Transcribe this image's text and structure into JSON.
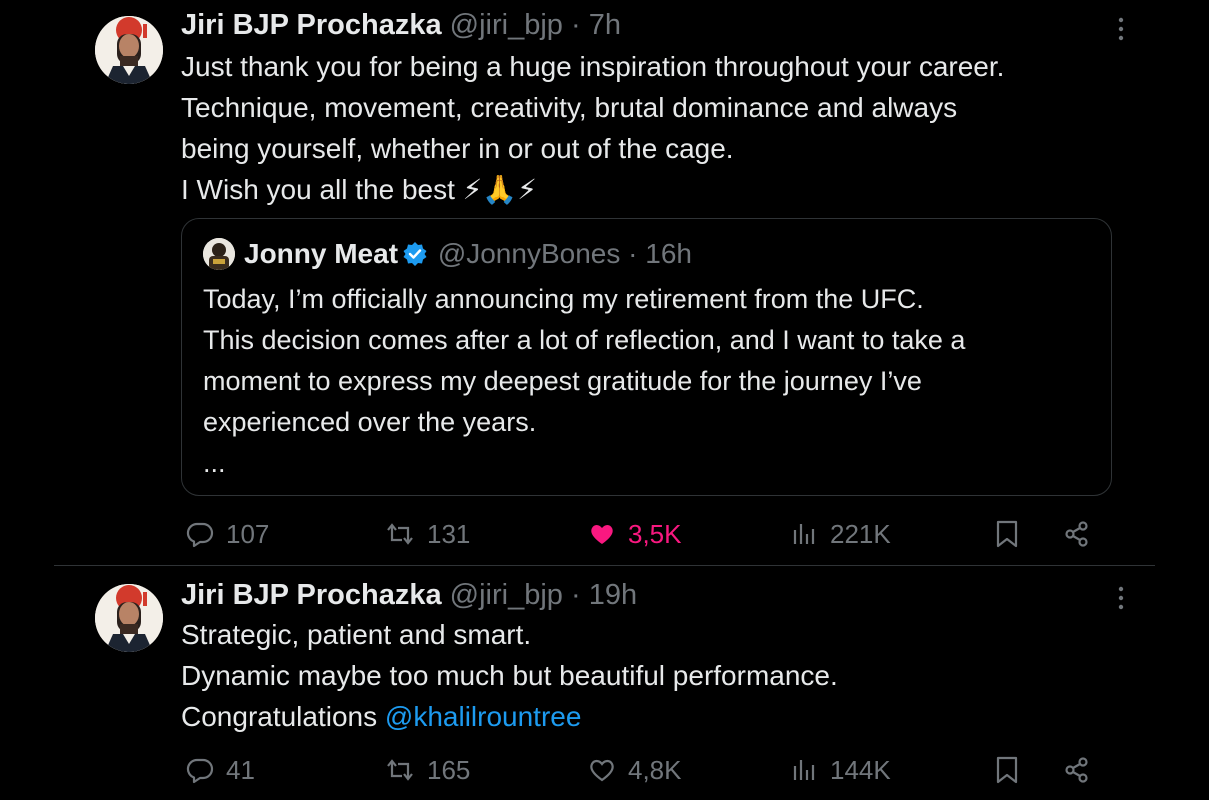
{
  "tweets": [
    {
      "author_name": "Jiri BJP Prochazka",
      "author_handle": "@jiri_bjp",
      "time": "7h",
      "lines": [
        "Just thank you for being a huge inspiration throughout your career.",
        "Technique, movement, creativity, brutal dominance and always",
        "being yourself, whether in or out of the cage.",
        "I Wish you all the best ⚡🙏⚡"
      ],
      "quote": {
        "author_name": "Jonny Meat",
        "author_handle": "@JonnyBones",
        "time": "16h",
        "verified": true,
        "lines": [
          "Today, I’m officially announcing my retirement from the UFC.",
          "This decision comes after a lot of reflection, and I want to take a",
          "moment to express my deepest gratitude for the journey I’ve",
          "experienced over the years.",
          "..."
        ]
      },
      "stats": {
        "replies": "107",
        "reposts": "131",
        "likes": "3,5K",
        "views": "221K",
        "liked": true
      }
    },
    {
      "author_name": "Jiri BJP Prochazka",
      "author_handle": "@jiri_bjp",
      "time": "19h",
      "lines": [
        "Strategic, patient and smart.",
        "Dynamic maybe too much but beautiful performance.",
        "Congratulations "
      ],
      "mention": "@khalilrountree",
      "stats": {
        "replies": "41",
        "reposts": "165",
        "likes": "4,8K",
        "views": "144K",
        "liked": false
      }
    }
  ],
  "separator": "·",
  "colors": {
    "background": "#000000",
    "text": "#e7e9ea",
    "muted": "#71767b",
    "link": "#1d9bf0",
    "like": "#f91880",
    "border": "#2f3336"
  },
  "icons": [
    "more-icon",
    "verified-icon",
    "reply-icon",
    "repost-icon",
    "like-icon",
    "views-icon",
    "bookmark-icon",
    "share-icon"
  ]
}
